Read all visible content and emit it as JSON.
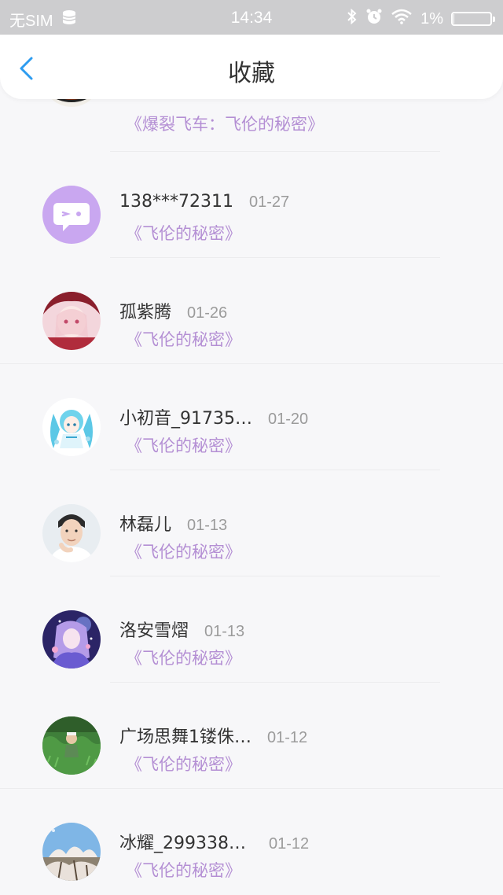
{
  "status_bar": {
    "carrier": "无SIM",
    "time": "14:34",
    "battery_percent": "1%",
    "battery_level": 0.01
  },
  "header": {
    "title": "收藏",
    "back_icon": "chevron-left-icon"
  },
  "colors": {
    "accent": "#2d9cf0",
    "work_title": "#b48fd4",
    "name": "#333333",
    "date": "#9b9b9b"
  },
  "items": [
    {
      "name": "",
      "date": "",
      "work": "《爆裂飞车：飞伦的秘密》",
      "avatar": "food-bowl-avatar"
    },
    {
      "name": "138***72311",
      "date": "01-27",
      "work": "《飞伦的秘密》",
      "avatar": "default-chat-avatar"
    },
    {
      "name": "孤紫腾",
      "date": "01-26",
      "work": "《飞伦的秘密》",
      "avatar": "anime-girl-avatar"
    },
    {
      "name": "小初音_91735…",
      "date": "01-20",
      "work": "《飞伦的秘密》",
      "avatar": "miku-avatar"
    },
    {
      "name": "林磊儿",
      "date": "01-13",
      "work": "《飞伦的秘密》",
      "avatar": "man-portrait-avatar"
    },
    {
      "name": "洛安雪熠",
      "date": "01-13",
      "work": "《飞伦的秘密》",
      "avatar": "anime-night-avatar"
    },
    {
      "name": "广场思舞1镂侏…",
      "date": "01-12",
      "work": "《飞伦的秘密》",
      "avatar": "grass-field-avatar"
    },
    {
      "name": "冰耀_2993382…",
      "date": "01-12",
      "work": "《飞伦的秘密》",
      "avatar": "blossom-tree-avatar"
    }
  ]
}
